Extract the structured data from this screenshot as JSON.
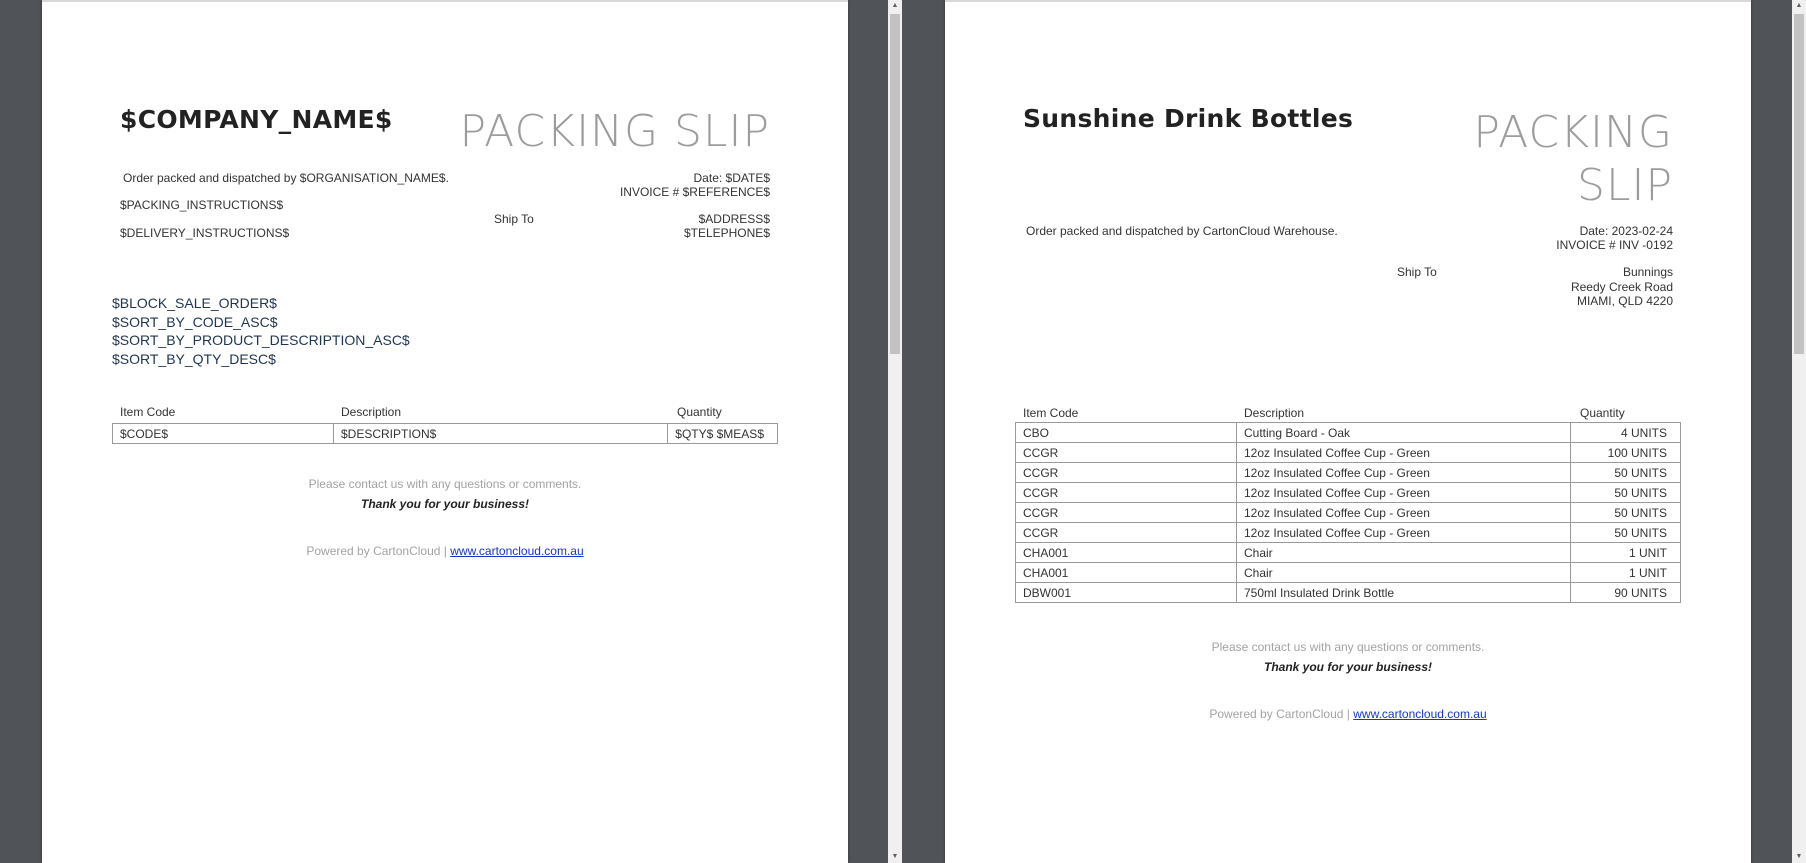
{
  "left_page": {
    "company_name": "$COMPANY_NAME$",
    "title": "PACKING SLIP",
    "packed_by": "Order packed and dispatched by $ORGANISATION_NAME$.",
    "packing_instructions": "$PACKING_INSTRUCTIONS$",
    "delivery_instructions": "$DELIVERY_INSTRUCTIONS$",
    "date": "Date: $DATE$",
    "invoice": "INVOICE # $REFERENCE$",
    "ship_to_label": "Ship To",
    "address": "$ADDRESS$",
    "telephone": "$TELEPHONE$",
    "template_lines": [
      "$BLOCK_SALE_ORDER$",
      "$SORT_BY_CODE_ASC$",
      "$SORT_BY_PRODUCT_DESCRIPTION_ASC$",
      "$SORT_BY_QTY_DESC$"
    ],
    "table": {
      "headers": [
        "Item Code",
        "Description",
        "Quantity"
      ],
      "rows": [
        [
          "$CODE$",
          "$DESCRIPTION$",
          "$QTY$ $MEAS$"
        ]
      ]
    },
    "contact_text": "Please contact us with any questions or comments.",
    "thank_you": "Thank you for your business!",
    "powered_by": "Powered by CartonCloud  |",
    "powered_link": "www.cartoncloud.com.au"
  },
  "right_page": {
    "company_name": "Sunshine Drink Bottles",
    "title_line1": "PACKING",
    "title_line2": "SLIP",
    "packed_by": "Order packed and dispatched by CartonCloud Warehouse.",
    "date": "Date: 2023-02-24",
    "invoice": "INVOICE # INV -0192",
    "ship_to_label": "Ship To",
    "address_lines": [
      "Bunnings",
      "Reedy Creek Road",
      "MIAMI, QLD 4220"
    ],
    "table": {
      "headers": [
        "Item Code",
        "Description",
        "Quantity"
      ],
      "rows": [
        [
          "CBO",
          "Cutting Board - Oak",
          "4 UNITS"
        ],
        [
          "CCGR",
          "12oz Insulated Coffee Cup - Green",
          "100 UNITS"
        ],
        [
          "CCGR",
          "12oz Insulated Coffee Cup - Green",
          "50 UNITS"
        ],
        [
          "CCGR",
          "12oz Insulated Coffee Cup - Green",
          "50 UNITS"
        ],
        [
          "CCGR",
          "12oz Insulated Coffee Cup - Green",
          "50 UNITS"
        ],
        [
          "CCGR",
          "12oz Insulated Coffee Cup - Green",
          "50 UNITS"
        ],
        [
          "CHA001",
          "Chair",
          "1 UNIT"
        ],
        [
          "CHA001",
          "Chair",
          "1 UNIT"
        ],
        [
          "DBW001",
          "750ml Insulated Drink Bottle",
          "90 UNITS"
        ]
      ]
    },
    "contact_text": "Please contact us with any questions or comments.",
    "thank_you": "Thank you for your business!",
    "powered_by": "Powered by CartonCloud |",
    "powered_link": "www.cartoncloud.com.au"
  },
  "icons": {
    "scroll_up": "scroll-up-arrow",
    "scroll_down": "scroll-down-arrow"
  }
}
